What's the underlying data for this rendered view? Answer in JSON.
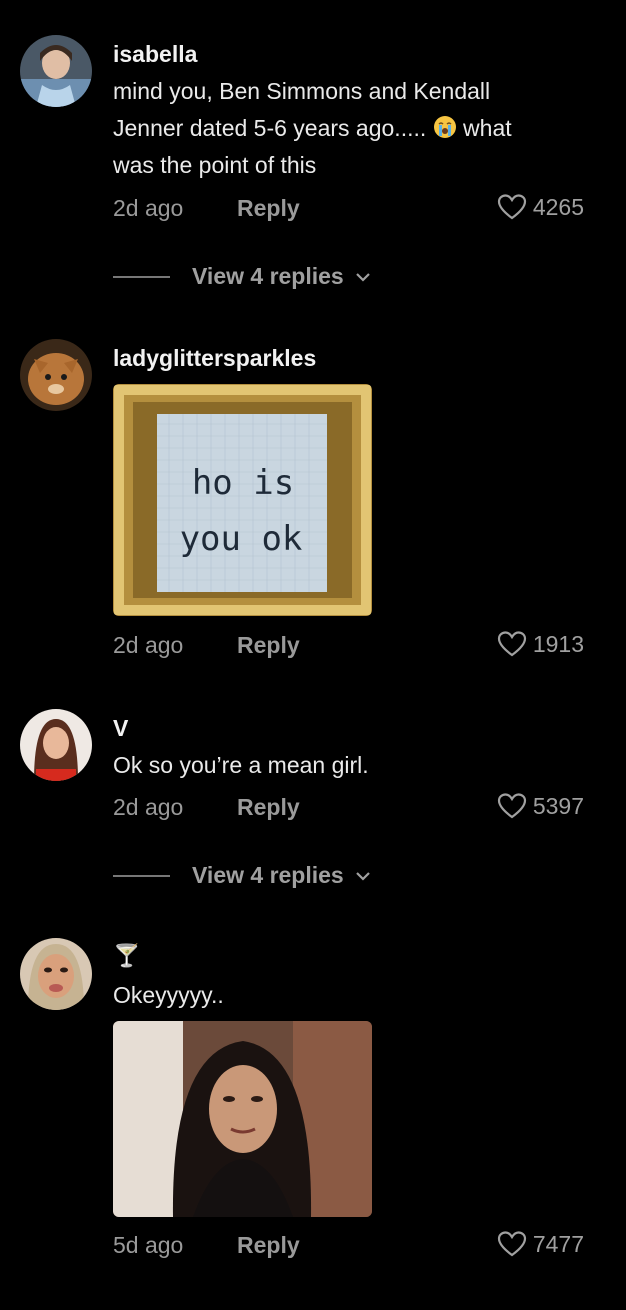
{
  "comments": [
    {
      "username": "isabella",
      "text_lines": [
        "mind you, Ben Simmons and Kendall",
        "Jenner dated 5-6 years ago.....",
        "what",
        "was the point of this"
      ],
      "time": "2d ago",
      "reply_label": "Reply",
      "likes": "4265",
      "view_replies": "View 4 replies"
    },
    {
      "username": "ladyglittersparkles",
      "image_text_line1": "ho is",
      "image_text_line2": "you ok",
      "time": "2d ago",
      "reply_label": "Reply",
      "likes": "1913"
    },
    {
      "username": "V",
      "text": "Ok so you’re a mean girl.",
      "time": "2d ago",
      "reply_label": "Reply",
      "likes": "5397",
      "view_replies": "View 4 replies"
    },
    {
      "username": "🍸",
      "text": "Okeyyyyy..",
      "time": "5d ago",
      "reply_label": "Reply",
      "likes": "7477"
    }
  ],
  "colors": {
    "background": "#000000",
    "muted": "#9a9a9a"
  }
}
